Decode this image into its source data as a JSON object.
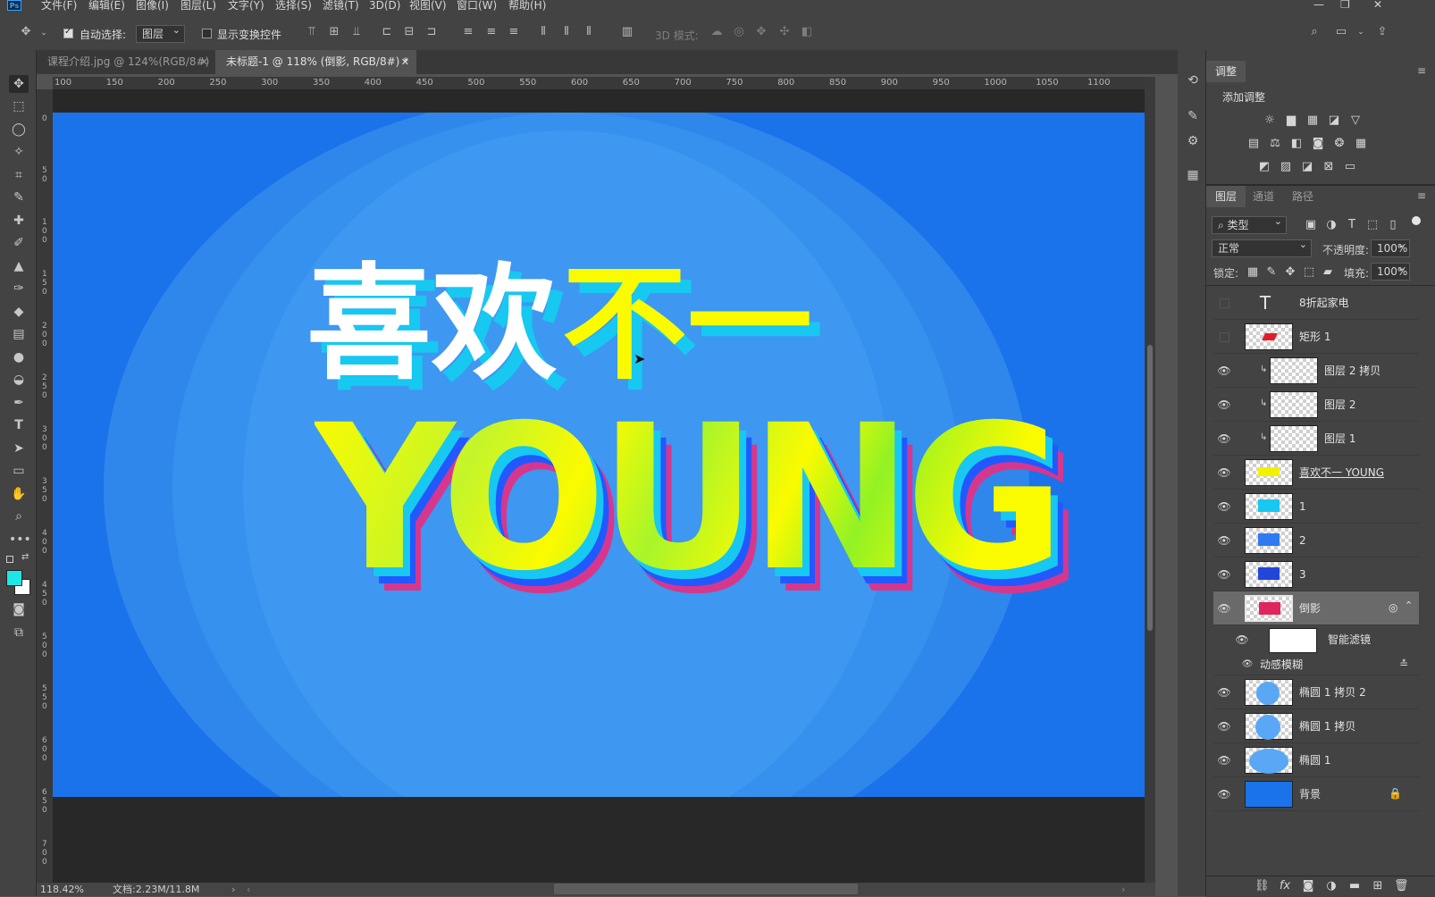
{
  "menu": [
    "文件(F)",
    "编辑(E)",
    "图像(I)",
    "图层(L)",
    "文字(Y)",
    "选择(S)",
    "滤镜(T)",
    "3D(D)",
    "视图(V)",
    "窗口(W)",
    "帮助(H)"
  ],
  "window_controls": [
    "—",
    "❐",
    "✕"
  ],
  "options": {
    "auto_select_label": "自动选择:",
    "auto_select_value": "图层",
    "show_transform_label": "显示变换控件",
    "mode_3d_label": "3D 模式:"
  },
  "tabs": [
    {
      "label": "课程介绍.jpg @ 124%(RGB/8#)",
      "active": false
    },
    {
      "label": "未标题-1 @ 118% (倒影, RGB/8#) *",
      "active": true
    }
  ],
  "ruler_h": [
    "100",
    "150",
    "200",
    "250",
    "300",
    "350",
    "400",
    "450",
    "500",
    "550",
    "600",
    "650",
    "700",
    "750",
    "800",
    "850",
    "900",
    "950",
    "1000",
    "1050",
    "1100"
  ],
  "ruler_v": [
    "0",
    "5 0",
    "1 0 0",
    "1 5 0",
    "2 0 0",
    "2 5 0",
    "3 0 0",
    "3 5 0",
    "4 0 0",
    "4 5 0",
    "5 0 0",
    "5 5 0",
    "6 0 0",
    "6 5 0",
    "7 0 0"
  ],
  "artwork": {
    "line1_white": "喜欢",
    "line1_yellow": "不一",
    "line2": "YOUNG",
    "colors": {
      "bg": "#1a73ea",
      "ring": "#3891ee",
      "white": "#ffffff",
      "yellow": "#fbfb00",
      "green": "#9ff230",
      "cyan": "#17c8f0",
      "shadow": "#d6378d"
    }
  },
  "status": {
    "zoom": "118.42%",
    "doc": "文档:2.23M/11.8M"
  },
  "adjust_panel": {
    "tab": "调整",
    "add_label": "添加调整"
  },
  "layers_panel": {
    "tabs": [
      "图层",
      "通道",
      "路径"
    ],
    "filter_label": "类型",
    "blend_mode": "正常",
    "opacity_label": "不透明度:",
    "opacity_value": "100%",
    "lock_label": "锁定:",
    "fill_label": "填充:",
    "fill_value": "100%",
    "layers": [
      {
        "name": "8折起家电",
        "visible": false,
        "type": "text"
      },
      {
        "name": "矩形 1",
        "visible": false,
        "type": "shape"
      },
      {
        "name": "图层 2 拷贝",
        "visible": true,
        "type": "clip"
      },
      {
        "name": "图层 2",
        "visible": true,
        "type": "clip"
      },
      {
        "name": "图层 1",
        "visible": true,
        "type": "clip"
      },
      {
        "name": "喜欢不一 YOUNG",
        "visible": true,
        "type": "smart"
      },
      {
        "name": "1",
        "visible": true,
        "type": "smart"
      },
      {
        "name": "2",
        "visible": true,
        "type": "smart"
      },
      {
        "name": "3",
        "visible": true,
        "type": "smart"
      },
      {
        "name": "倒影",
        "visible": true,
        "type": "smart-selected"
      },
      {
        "name": "智能滤镜",
        "visible": true,
        "type": "filter-mask"
      },
      {
        "name": "动感模糊",
        "visible": true,
        "type": "filter"
      },
      {
        "name": "椭圆 1 拷贝 2",
        "visible": true,
        "type": "ellipse"
      },
      {
        "name": "椭圆 1 拷贝",
        "visible": true,
        "type": "ellipse"
      },
      {
        "name": "椭圆 1",
        "visible": true,
        "type": "ellipse"
      },
      {
        "name": "背景",
        "visible": true,
        "type": "background"
      }
    ]
  }
}
